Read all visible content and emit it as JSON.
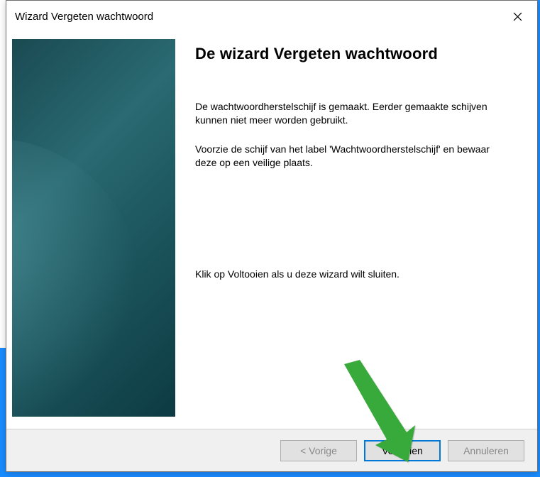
{
  "window": {
    "title": "Wizard Vergeten wachtwoord"
  },
  "content": {
    "heading": "De wizard Vergeten wachtwoord",
    "para1": "De wachtwoordherstelschijf is gemaakt. Eerder gemaakte schijven kunnen niet meer worden gebruikt.",
    "para2": "Voorzie de schijf van het label 'Wachtwoordherstelschijf' en bewaar deze op een veilige plaats.",
    "para3": "Klik op Voltooien als u deze wizard wilt sluiten."
  },
  "buttons": {
    "back": "< Vorige",
    "finish": "Voltooien",
    "cancel": "Annuleren"
  }
}
